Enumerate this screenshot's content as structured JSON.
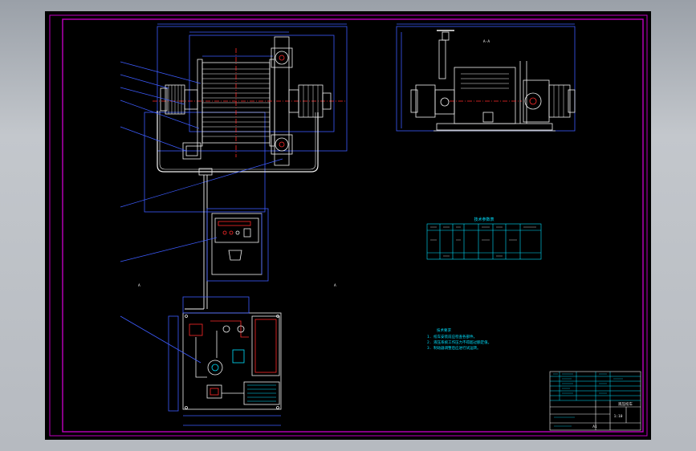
{
  "drawing": {
    "sheet_background": "#000000",
    "frame_color": "#c000c0",
    "line_colors": {
      "white": "#f2f2f2",
      "blue": "#3d5cff",
      "red": "#ff2a2a",
      "cyan": "#00e0ff",
      "yellow": "#f0e000",
      "magenta": "#e000e0"
    },
    "view_labels": {
      "front_view": "A-A",
      "left_view_a": "A",
      "left_view_b": "A"
    },
    "table_title": "技术参数表",
    "notes_heading": "技术要求",
    "notes": [
      "1. 绞车安装前应检查各部件。",
      "2. 液压系统工作压力不得超过额定值。",
      "3. 制动器调整后应进行试运转。"
    ],
    "title_block": {
      "drawing_title": "液压绞车",
      "scale": "1:10",
      "sheet": "A1"
    },
    "parts": [
      {
        "id": "part-1",
        "name": "cable-drum"
      },
      {
        "id": "part-2",
        "name": "hydraulic-motor"
      },
      {
        "id": "part-3",
        "name": "reducer"
      },
      {
        "id": "part-4",
        "name": "brake"
      },
      {
        "id": "part-5",
        "name": "junction-box"
      },
      {
        "id": "part-6",
        "name": "hose"
      },
      {
        "id": "part-7",
        "name": "control-cabinet"
      },
      {
        "id": "part-8",
        "name": "hydraulic-pump-station"
      }
    ]
  }
}
